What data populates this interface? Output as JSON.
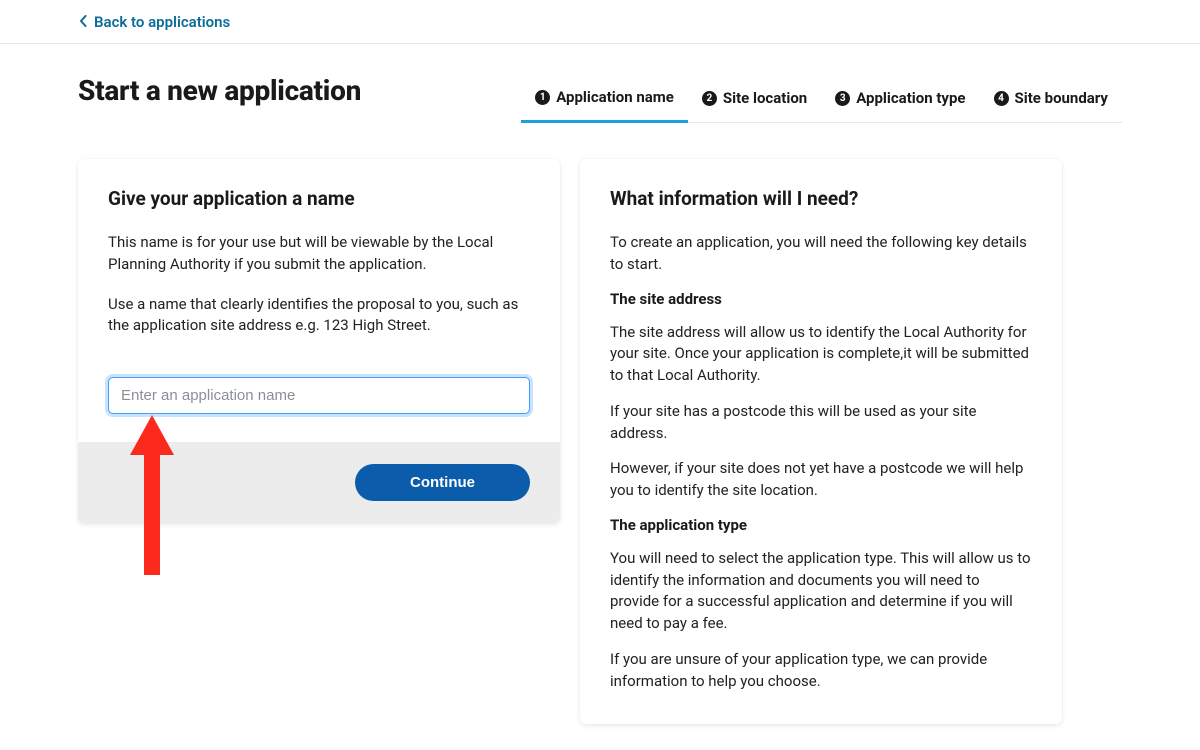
{
  "nav": {
    "back_label": "Back to applications"
  },
  "header": {
    "title": "Start a new application"
  },
  "steps": [
    {
      "num": "1",
      "label": "Application name",
      "active": true
    },
    {
      "num": "2",
      "label": "Site location",
      "active": false
    },
    {
      "num": "3",
      "label": "Application type",
      "active": false
    },
    {
      "num": "4",
      "label": "Site boundary",
      "active": false
    }
  ],
  "left": {
    "title": "Give your application a name",
    "para1": "This name is for your use but will be viewable by the Local Planning Authority if you submit the application.",
    "para2": "Use a name that clearly identifies the proposal to you, such as the application site address e.g. 123 High Street.",
    "placeholder": "Enter an application name",
    "continue_label": "Continue"
  },
  "right": {
    "title": "What information will I need?",
    "intro": "To create an application, you will need the following key details to start.",
    "sub1": "The site address",
    "text1": "The site address will allow us to identify the Local Authority for your site. Once your application is complete,it will be submitted to that Local Authority.",
    "text2": "If your site has a postcode this will be used as your site address.",
    "text3": "However, if your site does not yet have a postcode we will help you to identify the site location.",
    "sub2": "The application type",
    "text4": "You will need to select the application type. This will allow us to identify the information and documents you will need to provide for a successful application and determine if you will need to pay a fee.",
    "text5": "If you are unsure of your application type, we can provide information to help you choose."
  }
}
